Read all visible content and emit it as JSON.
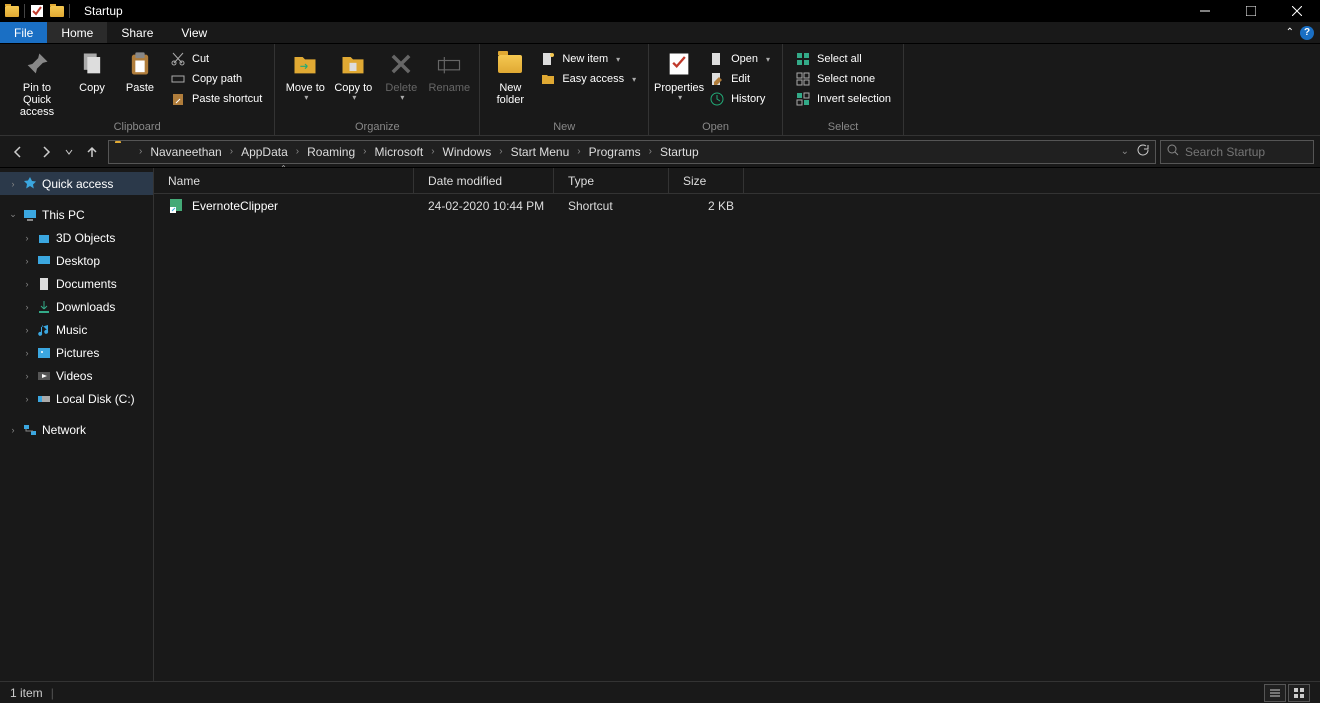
{
  "window": {
    "title": "Startup"
  },
  "tabs": {
    "file": "File",
    "home": "Home",
    "share": "Share",
    "view": "View"
  },
  "ribbon": {
    "clipboard": {
      "label": "Clipboard",
      "pin": "Pin to Quick access",
      "copy": "Copy",
      "paste": "Paste",
      "cut": "Cut",
      "copypath": "Copy path",
      "pasteshortcut": "Paste shortcut"
    },
    "organize": {
      "label": "Organize",
      "moveto": "Move to",
      "copyto": "Copy to",
      "delete": "Delete",
      "rename": "Rename"
    },
    "new": {
      "label": "New",
      "newfolder": "New folder",
      "newitem": "New item",
      "easyaccess": "Easy access"
    },
    "open": {
      "label": "Open",
      "properties": "Properties",
      "open": "Open",
      "edit": "Edit",
      "history": "History"
    },
    "select": {
      "label": "Select",
      "selectall": "Select all",
      "selectnone": "Select none",
      "invert": "Invert selection"
    }
  },
  "breadcrumb": [
    "Navaneethan",
    "AppData",
    "Roaming",
    "Microsoft",
    "Windows",
    "Start Menu",
    "Programs",
    "Startup"
  ],
  "search": {
    "placeholder": "Search Startup"
  },
  "tree": {
    "quickaccess": "Quick access",
    "thispc": "This PC",
    "items": [
      "3D Objects",
      "Desktop",
      "Documents",
      "Downloads",
      "Music",
      "Pictures",
      "Videos",
      "Local Disk (C:)"
    ],
    "network": "Network"
  },
  "columns": {
    "name": "Name",
    "date": "Date modified",
    "type": "Type",
    "size": "Size"
  },
  "rows": [
    {
      "name": "EvernoteClipper",
      "date": "24-02-2020 10:44 PM",
      "type": "Shortcut",
      "size": "2 KB"
    }
  ],
  "status": {
    "count": "1 item"
  }
}
